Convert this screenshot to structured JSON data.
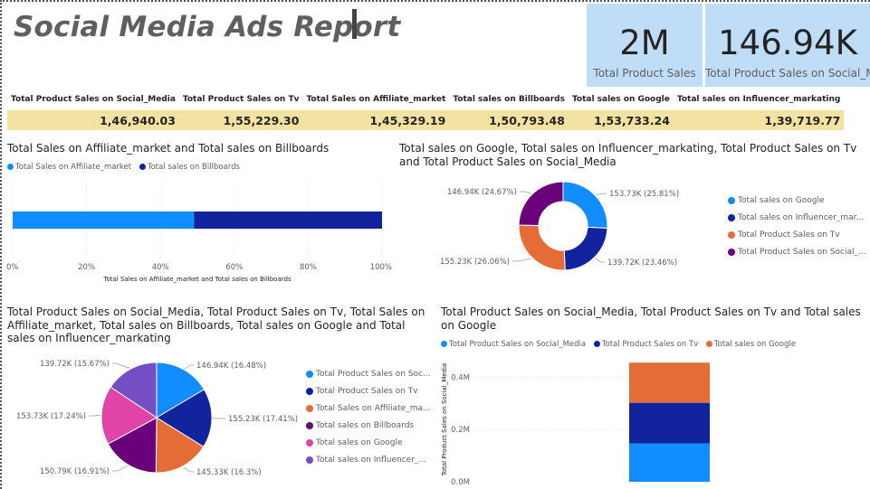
{
  "report_title": "Social Media Ads Report",
  "kpis": [
    {
      "value": "2M",
      "label": "Total Product Sales"
    },
    {
      "value": "146.94K",
      "label": "Total Product Sales on Social_M..."
    }
  ],
  "summary_table": {
    "headers": [
      "Total Product Sales on Social_Media",
      "Total Product Sales on Tv",
      "Total Sales on Affiliate_market",
      "Total sales on Billboards",
      "Total sales on Google",
      "Total sales on Influencer_markating"
    ],
    "values": [
      "1,46,940.03",
      "1,55,229.30",
      "1,45,329.19",
      "1,50,793.48",
      "1,53,733.24",
      "1,39,719.77"
    ]
  },
  "colors": {
    "blue": "#118dff",
    "navy": "#12239e",
    "orange": "#e66c37",
    "purple": "#6b007b",
    "pink": "#e044a7",
    "violet": "#744ec2",
    "kpi_bg": "#c0ddf7",
    "table_band": "#f2e3a2"
  },
  "chart_data": [
    {
      "type": "bar",
      "orientation": "horizontal-100%-stacked",
      "title": "Total Sales on Affiliate_market and Total sales on Billboards",
      "xlabel": "Total Sales on Affiliate_market and Total sales on Billboards",
      "x_ticks": [
        "0%",
        "20%",
        "40%",
        "60%",
        "80%",
        "100%"
      ],
      "series": [
        {
          "name": "Total Sales on Affiliate_market",
          "values": [
            145329.19
          ],
          "color": "#118dff"
        },
        {
          "name": "Total sales on Billboards",
          "values": [
            150793.48
          ],
          "color": "#12239e"
        }
      ],
      "legend": "top-left"
    },
    {
      "type": "pie",
      "variant": "donut",
      "title": "Total sales on Google, Total sales on Influencer_markating, Total Product Sales on Tv and Total Product Sales on Social_Media",
      "slices": [
        {
          "name": "Total sales on Google",
          "legend_label": "Total sales on Google",
          "value": 153.73,
          "label": "153.73K (25.81%)",
          "color": "#118dff"
        },
        {
          "name": "Total sales on Influencer_markating",
          "legend_label": "Total sales on Influencer_mar...",
          "value": 139.72,
          "label": "139.72K (23.46%)",
          "color": "#12239e"
        },
        {
          "name": "Total Product Sales on Tv",
          "legend_label": "Total Product Sales on Tv",
          "value": 155.23,
          "label": "155.23K (26.06%)",
          "color": "#e66c37"
        },
        {
          "name": "Total Product Sales on Social_Media",
          "legend_label": "Total Product Sales on Social_...",
          "value": 146.94,
          "label": "146.94K (24.67%)",
          "color": "#6b007b"
        }
      ],
      "legend": "right"
    },
    {
      "type": "pie",
      "title": "Total Product Sales on Social_Media, Total Product Sales on Tv, Total Sales on Affiliate_market, Total sales on Billboards, Total sales on Google and Total sales on Influencer_markating",
      "slices": [
        {
          "name": "Total Product Sales on Social_Media",
          "legend_label": "Total Product Sales on Soc...",
          "value": 146.94,
          "label": "146.94K (16.48%)",
          "color": "#118dff"
        },
        {
          "name": "Total Product Sales on Tv",
          "legend_label": "Total Product Sales on Tv",
          "value": 155.23,
          "label": "155.23K (17.41%)",
          "color": "#12239e"
        },
        {
          "name": "Total Sales on Affiliate_market",
          "legend_label": "Total Sales on Affiliate_ma...",
          "value": 145.33,
          "label": "145.33K (16.3%)",
          "color": "#e66c37"
        },
        {
          "name": "Total sales on Billboards",
          "legend_label": "Total sales on Billboards",
          "value": 150.79,
          "label": "150.79K (16.91%)",
          "color": "#6b007b"
        },
        {
          "name": "Total sales on Google",
          "legend_label": "Total sales on Google",
          "value": 153.73,
          "label": "153.73K (17.24%)",
          "color": "#e044a7"
        },
        {
          "name": "Total sales on Influencer_markating",
          "legend_label": "Total sales on Influencer_...",
          "value": 139.72,
          "label": "139.72K (15.67%)",
          "color": "#744ec2"
        }
      ],
      "legend": "right"
    },
    {
      "type": "bar",
      "orientation": "vertical-stacked",
      "title": "Total Product Sales on Social_Media, Total Product Sales on Tv and Total sales on Google",
      "ylabel": "Total Product Sales on Social_Media",
      "ylim": [
        0,
        0.46
      ],
      "y_ticks": [
        "0.0M",
        "0.2M",
        "0.4M"
      ],
      "y_tick_values": [
        0,
        0.2,
        0.4
      ],
      "series": [
        {
          "name": "Total Product Sales on Social_Media",
          "values": [
            0.14694
          ],
          "color": "#118dff"
        },
        {
          "name": "Total Product Sales on Tv",
          "values": [
            0.15523
          ],
          "color": "#12239e"
        },
        {
          "name": "Total sales on Google",
          "values": [
            0.15373
          ],
          "color": "#e66c37"
        }
      ],
      "legend": "top-left"
    }
  ]
}
